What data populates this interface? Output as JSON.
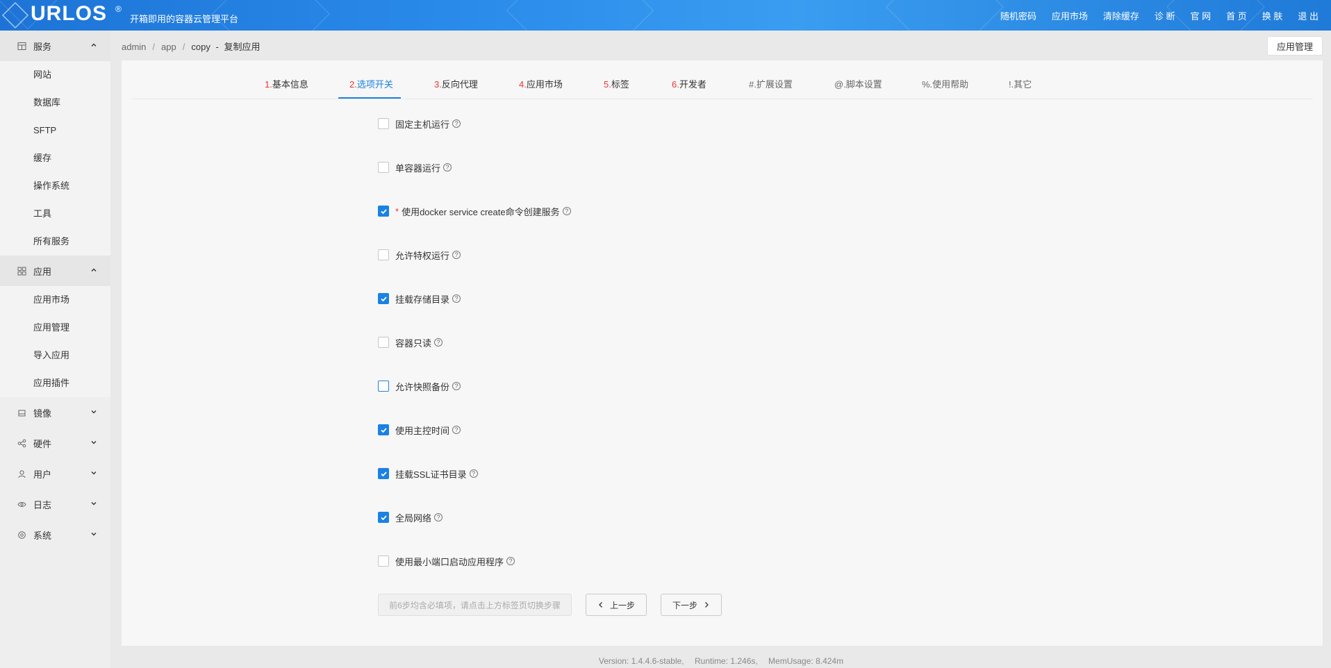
{
  "header": {
    "logo": "URLOS",
    "logo_reg": "®",
    "subtitle": "开箱即用的容器云管理平台",
    "nav": [
      "随机密码",
      "应用市场",
      "清除缓存",
      "诊 断",
      "官 网",
      "首 页",
      "换 肤",
      "退 出"
    ]
  },
  "sidebar": {
    "services": {
      "label": "服务",
      "items": [
        "网站",
        "数据库",
        "SFTP",
        "缓存",
        "操作系统",
        "工具",
        "所有服务"
      ]
    },
    "apps": {
      "label": "应用",
      "items": [
        "应用市场",
        "应用管理",
        "导入应用",
        "应用插件"
      ]
    },
    "collapsed": [
      "镜像",
      "硬件",
      "用户",
      "日志",
      "系统"
    ]
  },
  "breadcrumb": {
    "a": "admin",
    "b": "app",
    "c": "copy",
    "dash": "-",
    "d": "复制应用"
  },
  "top_button": "应用管理",
  "tabs": [
    {
      "num": "1.",
      "label": "基本信息"
    },
    {
      "num": "2.",
      "label": "选项开关"
    },
    {
      "num": "3.",
      "label": "反向代理"
    },
    {
      "num": "4.",
      "label": "应用市场"
    },
    {
      "num": "5.",
      "label": "标签"
    },
    {
      "num": "6.",
      "label": "开发者"
    },
    {
      "num": "",
      "label": "#.扩展设置"
    },
    {
      "num": "",
      "label": "@.脚本设置"
    },
    {
      "num": "",
      "label": "%.使用帮助"
    },
    {
      "num": "",
      "label": "!.其它"
    }
  ],
  "active_tab": 2,
  "options": [
    {
      "label": "固定主机运行",
      "checked": false,
      "required": false
    },
    {
      "label": "单容器运行",
      "checked": false,
      "required": false
    },
    {
      "label": "使用docker service create命令创建服务",
      "checked": true,
      "required": true
    },
    {
      "label": "允许特权运行",
      "checked": false,
      "required": false
    },
    {
      "label": "挂载存储目录",
      "checked": true,
      "required": false
    },
    {
      "label": "容器只读",
      "checked": false,
      "required": false
    },
    {
      "label": "允许快照备份",
      "checked": false,
      "required": false
    },
    {
      "label": "使用主控时间",
      "checked": true,
      "required": false
    },
    {
      "label": "挂载SSL证书目录",
      "checked": true,
      "required": false
    },
    {
      "label": "全局网络",
      "checked": true,
      "required": false
    },
    {
      "label": "使用最小端口启动应用程序",
      "checked": false,
      "required": false
    }
  ],
  "buttons": {
    "disabled": "前6步均含必填项，请点击上方标签页切换步骤",
    "prev": "上一步",
    "next": "下一步"
  },
  "footer": {
    "version": "Version: 1.4.4.6-stable,",
    "runtime": "Runtime: 1.246s,",
    "mem": "MemUsage: 8.424m"
  }
}
